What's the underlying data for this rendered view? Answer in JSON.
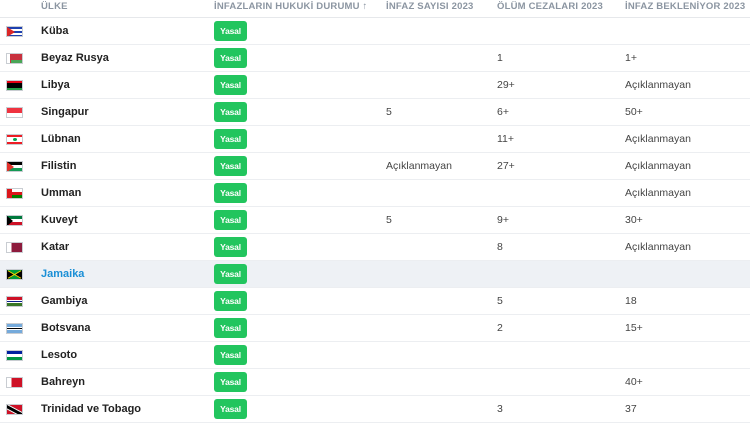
{
  "columns": {
    "country": "ÜLKE",
    "legal": "İNFAZLARIN HUKUKİ DURUMU ↑",
    "executions": "İNFAZ SAYISI 2023",
    "death_sentences": "ÖLÜM CEZALARI 2023",
    "awaiting": "İNFAZ BEKLENİYOR 2023"
  },
  "rows": [
    {
      "country": "Küba",
      "legal": "Yasal",
      "executions": "",
      "death_sentences": "",
      "awaiting": "",
      "flag": "cuba-flag-icon"
    },
    {
      "country": "Beyaz Rusya",
      "legal": "Yasal",
      "executions": "",
      "death_sentences": "1",
      "awaiting": "1+",
      "flag": "belarus-flag-icon"
    },
    {
      "country": "Libya",
      "legal": "Yasal",
      "executions": "",
      "death_sentences": "29+",
      "awaiting": "Açıklanmayan",
      "flag": "libya-flag-icon"
    },
    {
      "country": "Singapur",
      "legal": "Yasal",
      "executions": "5",
      "death_sentences": "6+",
      "awaiting": "50+",
      "flag": "singapore-flag-icon"
    },
    {
      "country": "Lübnan",
      "legal": "Yasal",
      "executions": "",
      "death_sentences": "11+",
      "awaiting": "Açıklanmayan",
      "flag": "lebanon-flag-icon"
    },
    {
      "country": "Filistin",
      "legal": "Yasal",
      "executions": "Açıklanmayan",
      "death_sentences": "27+",
      "awaiting": "Açıklanmayan",
      "flag": "palestine-flag-icon"
    },
    {
      "country": "Umman",
      "legal": "Yasal",
      "executions": "",
      "death_sentences": "",
      "awaiting": "Açıklanmayan",
      "flag": "oman-flag-icon"
    },
    {
      "country": "Kuveyt",
      "legal": "Yasal",
      "executions": "5",
      "death_sentences": "9+",
      "awaiting": "30+",
      "flag": "kuwait-flag-icon"
    },
    {
      "country": "Katar",
      "legal": "Yasal",
      "executions": "",
      "death_sentences": "8",
      "awaiting": "Açıklanmayan",
      "flag": "qatar-flag-icon"
    },
    {
      "country": "Jamaika",
      "legal": "Yasal",
      "executions": "",
      "death_sentences": "",
      "awaiting": "",
      "flag": "jamaica-flag-icon"
    },
    {
      "country": "Gambiya",
      "legal": "Yasal",
      "executions": "",
      "death_sentences": "5",
      "awaiting": "18",
      "flag": "gambia-flag-icon"
    },
    {
      "country": "Botsvana",
      "legal": "Yasal",
      "executions": "",
      "death_sentences": "2",
      "awaiting": "15+",
      "flag": "botswana-flag-icon"
    },
    {
      "country": "Lesoto",
      "legal": "Yasal",
      "executions": "",
      "death_sentences": "",
      "awaiting": "",
      "flag": "lesotho-flag-icon"
    },
    {
      "country": "Bahreyn",
      "legal": "Yasal",
      "executions": "",
      "death_sentences": "",
      "awaiting": "40+",
      "flag": "bahrain-flag-icon"
    },
    {
      "country": "Trinidad ve Tobago",
      "legal": "Yasal",
      "executions": "",
      "death_sentences": "3",
      "awaiting": "37",
      "flag": "trinidad-tobago-flag-icon"
    }
  ],
  "colors": {
    "legal_badge": "#22c55e",
    "link": "#1a8fd6",
    "highlight_row": "#eef1f5"
  }
}
